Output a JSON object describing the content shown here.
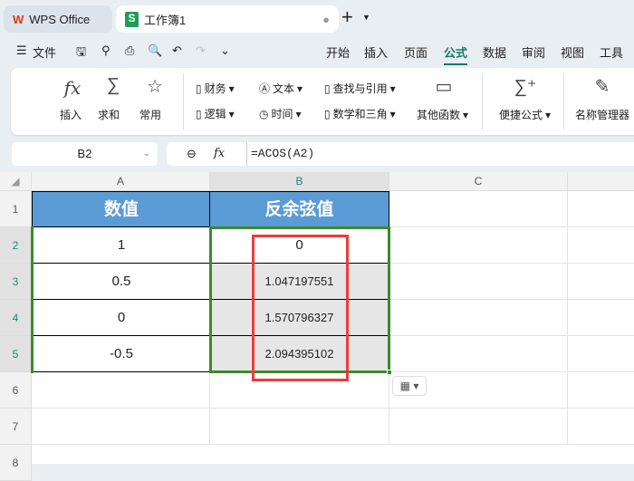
{
  "tabs": {
    "home": "WPS Office",
    "doc": "工作簿1"
  },
  "menu": {
    "file": "文件",
    "items": [
      "开始",
      "插入",
      "页面",
      "公式",
      "数据",
      "审阅",
      "视图",
      "工具"
    ],
    "active": "公式"
  },
  "ribbon": {
    "insert": "插入",
    "sum": "求和",
    "common": "常用",
    "finance": "财务",
    "logic": "逻辑",
    "text": "文本",
    "time": "时间",
    "lookup": "查找与引用",
    "math": "数学和三角",
    "other": "其他函数",
    "quick": "便捷公式",
    "names": "名称管理器"
  },
  "formula_bar": {
    "cell_ref": "B2",
    "formula": "=ACOS(A2)"
  },
  "columns": [
    "A",
    "B",
    "C"
  ],
  "rows": [
    "1",
    "2",
    "3",
    "4",
    "5",
    "6",
    "7",
    "8"
  ],
  "table": {
    "headers": [
      "数值",
      "反余弦值"
    ],
    "rows": [
      [
        "1",
        "0"
      ],
      [
        "0.5",
        "1.047197551"
      ],
      [
        "0",
        "1.570796327"
      ],
      [
        "-0.5",
        "2.094395102"
      ]
    ]
  },
  "colors": {
    "header": "#5b9bd5",
    "selection": "#3d8b2a",
    "highlight": "#ef3b3b",
    "accent": "#117a65"
  }
}
